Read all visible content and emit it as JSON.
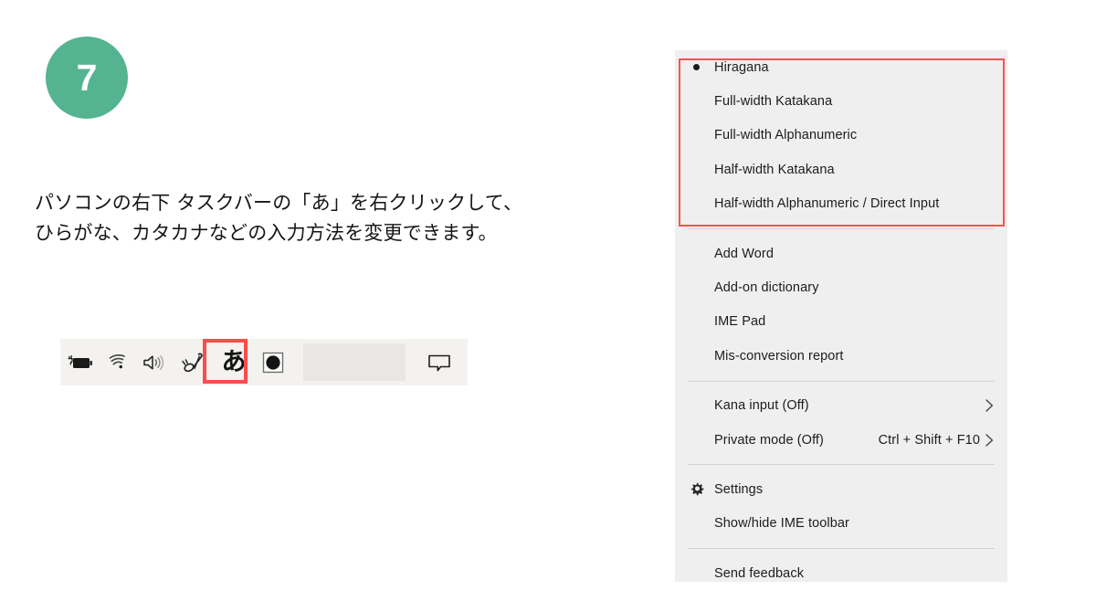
{
  "step": {
    "number": "7"
  },
  "instructions": {
    "line1": "パソコンの右下 タスクバーの「あ」を右クリックして、",
    "line2": "ひらがな、カタカナなどの入力方法を変更できます。"
  },
  "taskbar": {
    "icons": [
      {
        "name": "battery-charging-icon",
        "label": ""
      },
      {
        "name": "wifi-icon",
        "label": ""
      },
      {
        "name": "volume-icon",
        "label": ""
      },
      {
        "name": "ime-pen-icon",
        "label": ""
      },
      {
        "name": "ime-hiragana-icon",
        "label": "あ"
      },
      {
        "name": "ime-mode-icon",
        "label": ""
      },
      {
        "name": "chat-notification-icon",
        "label": ""
      }
    ]
  },
  "ime_menu": {
    "input_modes": [
      {
        "label": "Hiragana",
        "selected": true
      },
      {
        "label": "Full-width Katakana",
        "selected": false
      },
      {
        "label": "Full-width Alphanumeric",
        "selected": false
      },
      {
        "label": "Half-width Katakana",
        "selected": false
      },
      {
        "label": "Half-width Alphanumeric / Direct Input",
        "selected": false
      }
    ],
    "tools": [
      {
        "label": "Add Word"
      },
      {
        "label": "Add-on dictionary"
      },
      {
        "label": "IME Pad"
      },
      {
        "label": "Mis-conversion report"
      }
    ],
    "toggles": [
      {
        "label": "Kana input (Off)",
        "shortcut": "",
        "chevron": "›"
      },
      {
        "label": "Private mode (Off)",
        "shortcut": "Ctrl + Shift + F10",
        "chevron": "›"
      }
    ],
    "settings": [
      {
        "label": "Settings",
        "icon": "gear-icon"
      },
      {
        "label": "Show/hide IME toolbar",
        "icon": ""
      }
    ],
    "feedback": [
      {
        "label": "Send feedback"
      }
    ]
  },
  "colors": {
    "badge_green": "#54b391",
    "highlight_red": "#fc4c4c",
    "menu_background": "#efefef",
    "taskbar_background": "#f3f2ef"
  }
}
